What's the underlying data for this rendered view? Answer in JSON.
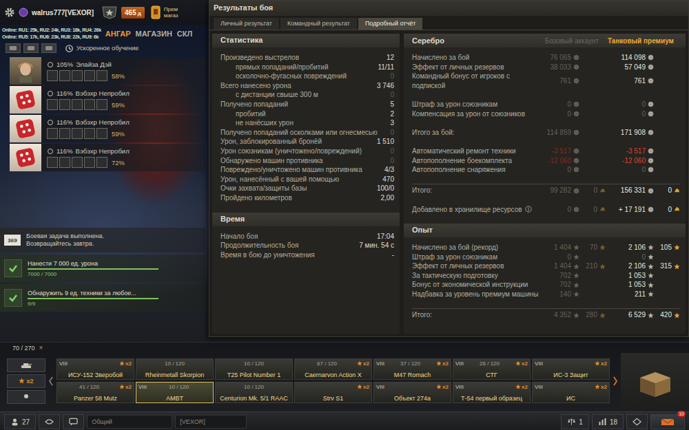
{
  "topbar": {
    "account": "walrus777[VEXOR]",
    "premium_days": "465",
    "premium_days_unit": "д",
    "premium_shop": [
      "Прем",
      "магаз"
    ]
  },
  "online": [
    "Online: RU1: 25k, RU2: 24k, RU3: 18k, RU4: 26k",
    "Online: RU5: 17k, RU6: 23k, RU8: 22k, RU9: 6k"
  ],
  "nav": [
    {
      "label": "АНГАР",
      "selected": true
    },
    {
      "label": "МАГАЗИН",
      "selected": false
    },
    {
      "label": "СКЛ",
      "selected": false
    }
  ],
  "crew_toolbar": {
    "label": "Ускоренное обучение"
  },
  "crew": [
    {
      "skill": "105%",
      "name": "Элайза Дэй",
      "progress": "58%",
      "kind": "portrait"
    },
    {
      "skill": "116%",
      "name": "Вэбэхр Непробил",
      "progress": "59%",
      "kind": "dice"
    },
    {
      "skill": "116%",
      "name": "Вэбэхр Непробил",
      "progress": "59%",
      "kind": "dice"
    },
    {
      "skill": "116%",
      "name": "Вэбэхр Непробил",
      "progress": "72%",
      "kind": "dice"
    }
  ],
  "missions": {
    "counter": "369",
    "status": [
      "Боевая задача выполнена.",
      "Возвращайтесь завтра."
    ],
    "items": [
      {
        "title": "Нанести 7 000 ед. урона",
        "reading": "7000 / 7000",
        "level": 1,
        "done": true
      },
      {
        "title": "Обнаружить 9 ед. техники за любое...",
        "reading": "9/9",
        "level": 1,
        "done": true
      }
    ]
  },
  "carousel": {
    "count": "70 / 270",
    "close": "×",
    "filter_bonus": "x2",
    "tanks": [
      {
        "tier": "VIII",
        "name": "ИСУ-152 Зверобой",
        "count": "",
        "bonus": "x2",
        "selected": false
      },
      {
        "tier": "",
        "name": "Rheinmetall Skorpion",
        "count": "10 / 120",
        "bonus": "",
        "selected": false
      },
      {
        "tier": "",
        "name": "T25 Pilot Number 1",
        "count": "10 / 120",
        "bonus": "",
        "selected": false
      },
      {
        "tier": "",
        "name": "Caernarvon Action X",
        "count": "67 / 120",
        "bonus": "x2",
        "selected": false
      },
      {
        "tier": "VIII",
        "name": "M47 Romach",
        "count": "37 / 120",
        "bonus": "x2",
        "selected": false
      },
      {
        "tier": "VIII",
        "name": "СТГ",
        "count": "26 / 120",
        "bonus": "x2",
        "selected": false
      },
      {
        "tier": "VIII",
        "name": "ИС-3 Защит",
        "count": "",
        "bonus": "x2",
        "selected": false
      },
      {
        "tier": "",
        "name": "Panzer 58 Mutz",
        "count": "41 / 120",
        "bonus": "x2",
        "selected": false
      },
      {
        "tier": "VIII",
        "name": "AMBT",
        "count": "10 / 120",
        "bonus": "",
        "selected": true
      },
      {
        "tier": "",
        "name": "Centurion Mk. 5/1 RAAC",
        "count": "10 / 120",
        "bonus": "",
        "selected": false
      },
      {
        "tier": "",
        "name": "Strv S1",
        "count": "",
        "bonus": "x2",
        "selected": false
      },
      {
        "tier": "VIII",
        "name": "Объект 274a",
        "count": "",
        "bonus": "x2",
        "selected": false
      },
      {
        "tier": "VIII",
        "name": "Т-54 первый образец",
        "count": "",
        "bonus": "x2",
        "selected": false
      },
      {
        "tier": "VIII",
        "name": "ИС",
        "count": "",
        "bonus": "x2",
        "selected": false
      }
    ]
  },
  "bottom_bar": {
    "players": "27",
    "channel": "Общий",
    "clan": "[VEXOR]",
    "squad": "1",
    "counter": "18",
    "notifications": "10"
  },
  "results": {
    "title": "Результаты боя",
    "tabs": [
      {
        "label": "Личный результат",
        "selected": false
      },
      {
        "label": "Командный результат",
        "selected": false
      },
      {
        "label": "Подробный отчёт",
        "selected": true
      }
    ],
    "statistics": {
      "title": "Статистика",
      "rows": [
        {
          "label": "Произведено выстрелов",
          "value": "12",
          "kind": "main",
          "dimmed": false
        },
        {
          "label": "прямых попаданий/пробитий",
          "value": "11/11",
          "kind": "sub",
          "dimmed": false
        },
        {
          "label": "осколочно-фугасных повреждений",
          "value": "0",
          "kind": "sub",
          "dimmed": true
        },
        {
          "label": "Всего нанесено урона",
          "value": "3 746",
          "kind": "main",
          "dimmed": false
        },
        {
          "label": "с дистанции свыше 300 м",
          "value": "0",
          "kind": "sub",
          "dimmed": true
        },
        {
          "label": "Получено попаданий",
          "value": "5",
          "kind": "main",
          "dimmed": false
        },
        {
          "label": "пробитий",
          "value": "2",
          "kind": "sub",
          "dimmed": false
        },
        {
          "label": "не нанёсших урон",
          "value": "3",
          "kind": "sub",
          "dimmed": false
        },
        {
          "label": "Получено попаданий осколками или огнесмесью",
          "value": "0",
          "kind": "main",
          "dimmed": true
        },
        {
          "label": "Урон, заблокированный бронёй",
          "value": "1 510",
          "kind": "main",
          "dimmed": false
        },
        {
          "label": "Урон союзникам (уничтожено/повреждений)",
          "value": "0",
          "kind": "main",
          "dimmed": true
        },
        {
          "label": "Обнаружено машин противника",
          "value": "0",
          "kind": "main",
          "dimmed": true
        },
        {
          "label": "Повреждено/уничтожено машин противника",
          "value": "4/3",
          "kind": "main",
          "dimmed": false
        },
        {
          "label": "Урон, нанесённый с вашей помощью",
          "value": "470",
          "kind": "main",
          "dimmed": false
        },
        {
          "label": "Очки захвата/защиты базы",
          "value": "100/0",
          "kind": "main",
          "dimmed": false
        },
        {
          "label": "Пройдено километров",
          "value": "2,00",
          "kind": "main",
          "dimmed": false
        }
      ]
    },
    "time": {
      "title": "Время",
      "rows": [
        {
          "label": "Начало боя",
          "value": "17:04"
        },
        {
          "label": "Продолжительность боя",
          "value": "7 мин. 54 с"
        },
        {
          "label": "Время в бою до уничтожения",
          "value": "-"
        }
      ]
    },
    "silver": {
      "title": "Серебро",
      "base_header": "Базовый аккаунт",
      "premium_header": "Танковый премиум",
      "groups": [
        [
          {
            "label": "Начислено за бой",
            "base": "76 065",
            "base_alt": "",
            "prem": "114 098",
            "prem_alt": "",
            "kind": "normal",
            "dimmed": false,
            "info": false
          },
          {
            "label": "Эффект от личных резервов",
            "base": "38 033",
            "base_alt": "",
            "prem": "57 049",
            "prem_alt": "",
            "kind": "normal",
            "dimmed": false,
            "info": false
          },
          {
            "label": "Командный бонус от игроков с подпиской",
            "base": "761",
            "base_alt": "",
            "prem": "761",
            "prem_alt": "",
            "kind": "normal",
            "dimmed": false,
            "info": false
          }
        ],
        [
          {
            "label": "Штраф за урон союзникам",
            "base": "0",
            "base_alt": "",
            "prem": "0",
            "prem_alt": "",
            "kind": "normal",
            "dimmed": true,
            "info": false
          },
          {
            "label": "Компенсация за урон от союзников",
            "base": "0",
            "base_alt": "",
            "prem": "0",
            "prem_alt": "",
            "kind": "normal",
            "dimmed": true,
            "info": false
          }
        ],
        [
          {
            "label": "Итого за бой:",
            "base": "114 859",
            "base_alt": "",
            "prem": "171 908",
            "prem_alt": "",
            "kind": "normal",
            "dimmed": false,
            "info": false
          }
        ],
        [
          {
            "label": "Автоматический ремонт техники",
            "base": "-3 517",
            "base_alt": "",
            "prem": "-3 517",
            "prem_alt": "",
            "kind": "negative",
            "dimmed": false,
            "info": false
          },
          {
            "label": "Автопополнение боекомплекта",
            "base": "-12 060",
            "base_alt": "",
            "prem": "-12 060",
            "prem_alt": "",
            "kind": "negative",
            "dimmed": false,
            "info": false
          },
          {
            "label": "Автопополнение снаряжения",
            "base": "0",
            "base_alt": "",
            "prem": "0",
            "prem_alt": "",
            "kind": "normal",
            "dimmed": true,
            "info": false
          }
        ],
        [
          {
            "label": "Итого:",
            "base": "99 282",
            "base_alt": "0",
            "prem": "156 331",
            "prem_alt": "0",
            "kind": "total",
            "dimmed": false,
            "info": false
          }
        ],
        [
          {
            "label": "Добавлено в хранилище ресурсов",
            "base": "0",
            "base_alt": "0",
            "prem": "+ 17 191",
            "prem_alt": "0",
            "kind": "normal",
            "dimmed": false,
            "info": true
          }
        ]
      ]
    },
    "experience": {
      "title": "Опыт",
      "groups": [
        [
          {
            "label": "Начислено за бой (рекорд)",
            "base": "1 404",
            "base_alt": "70",
            "prem": "2 106",
            "prem_alt": "105",
            "kind": "normal",
            "dimmed": false
          },
          {
            "label": "Штраф за урон союзникам",
            "base": "0",
            "base_alt": "",
            "prem": "0",
            "prem_alt": "",
            "kind": "normal",
            "dimmed": true
          },
          {
            "label": "Эффект от личных резервов",
            "base": "1 404",
            "base_alt": "210",
            "prem": "2 106",
            "prem_alt": "315",
            "kind": "normal",
            "dimmed": false
          },
          {
            "label": "За тактическую подготовку",
            "base": "702",
            "base_alt": "",
            "prem": "1 053",
            "prem_alt": "",
            "kind": "normal",
            "dimmed": false
          },
          {
            "label": "Бонус от экономической инструкции",
            "base": "702",
            "base_alt": "",
            "prem": "1 053",
            "prem_alt": "",
            "kind": "normal",
            "dimmed": false
          },
          {
            "label": "Надбавка за уровень премиум машины",
            "base": "140",
            "base_alt": "",
            "prem": "211",
            "prem_alt": "",
            "kind": "normal",
            "dimmed": false
          }
        ],
        [
          {
            "label": "Итого:",
            "base": "4 352",
            "base_alt": "280",
            "prem": "6 529",
            "prem_alt": "420",
            "kind": "total",
            "dimmed": false
          }
        ]
      ]
    }
  }
}
